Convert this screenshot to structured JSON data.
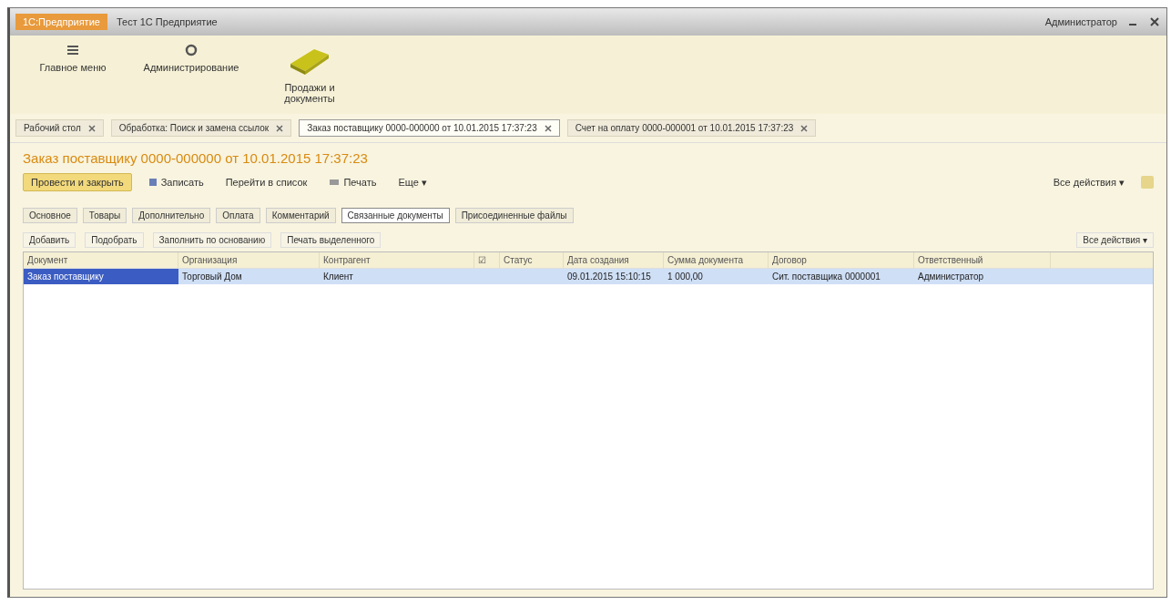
{
  "window": {
    "app_name": "1С:Предприятие",
    "title": "Тест 1С Предприятие",
    "user": "Администратор"
  },
  "sections": [
    {
      "label": "Главное меню",
      "kind": "menu"
    },
    {
      "label": "Администрирование",
      "kind": "gear"
    },
    {
      "label": "Продажи и документы",
      "kind": "box"
    }
  ],
  "open_tabs": [
    {
      "label": "Рабочий стол",
      "selected": false
    },
    {
      "label": "Обработка: Поиск и замена ссылок",
      "selected": false
    },
    {
      "label": "Заказ поставщику 0000-000000 от 10.01.2015 17:37:23",
      "selected": true
    },
    {
      "label": "Счет на оплату 0000-000001 от 10.01.2015 17:37:23",
      "selected": false
    }
  ],
  "form": {
    "title": "Заказ поставщику 0000-000000 от 10.01.2015 17:37:23",
    "commands": [
      {
        "label": "Провести и закрыть",
        "kind": "primary"
      },
      {
        "label": "Записать",
        "kind": "save"
      },
      {
        "label": "Перейти в список",
        "kind": "plain"
      },
      {
        "label": "Печать",
        "kind": "print"
      },
      {
        "label": "Еще ▾",
        "kind": "plain"
      }
    ],
    "all_actions": "Все действия ▾",
    "tabs": [
      {
        "label": "Основное",
        "selected": false
      },
      {
        "label": "Товары",
        "selected": false
      },
      {
        "label": "Дополнительно",
        "selected": false
      },
      {
        "label": "Оплата",
        "selected": false
      },
      {
        "label": "Комментарий",
        "selected": false
      },
      {
        "label": "Связанные документы",
        "selected": true
      },
      {
        "label": "Присоединенные файлы",
        "selected": false
      }
    ]
  },
  "table": {
    "toolbar": [
      "Добавить",
      "Подобрать",
      "Заполнить по основанию",
      "Печать выделенного"
    ],
    "all_actions": "Все действия ▾",
    "columns": [
      "Документ",
      "Организация",
      "Контрагент",
      "☑",
      "Статус",
      "Дата создания",
      "Сумма документа",
      "Договор",
      "Ответственный"
    ],
    "rows": [
      {
        "selected": true,
        "cells": [
          "Заказ поставщику",
          "Торговый Дом",
          "Клиент",
          "",
          "",
          "09.01.2015 15:10:15",
          "1 000,00",
          "Сит. поставщика 0000001",
          "Администратор"
        ]
      }
    ]
  }
}
